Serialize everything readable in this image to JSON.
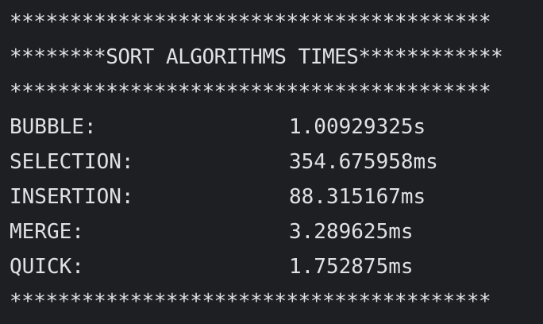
{
  "console": {
    "border_top": "****************************************",
    "title_line": "********SORT ALGORITHMS TIMES************",
    "border_mid": "****************************************",
    "rows": [
      {
        "label": "BUBBLE:",
        "time": "1.00929325s"
      },
      {
        "label": "SELECTION:",
        "time": "354.675958ms"
      },
      {
        "label": "INSERTION:",
        "time": "88.315167ms"
      },
      {
        "label": "MERGE:",
        "time": "3.289625ms"
      },
      {
        "label": "QUICK:",
        "time": "1.752875ms"
      }
    ],
    "border_bottom": "****************************************"
  },
  "colors": {
    "background": "#1e1f22",
    "text": "#dfe1e5"
  }
}
